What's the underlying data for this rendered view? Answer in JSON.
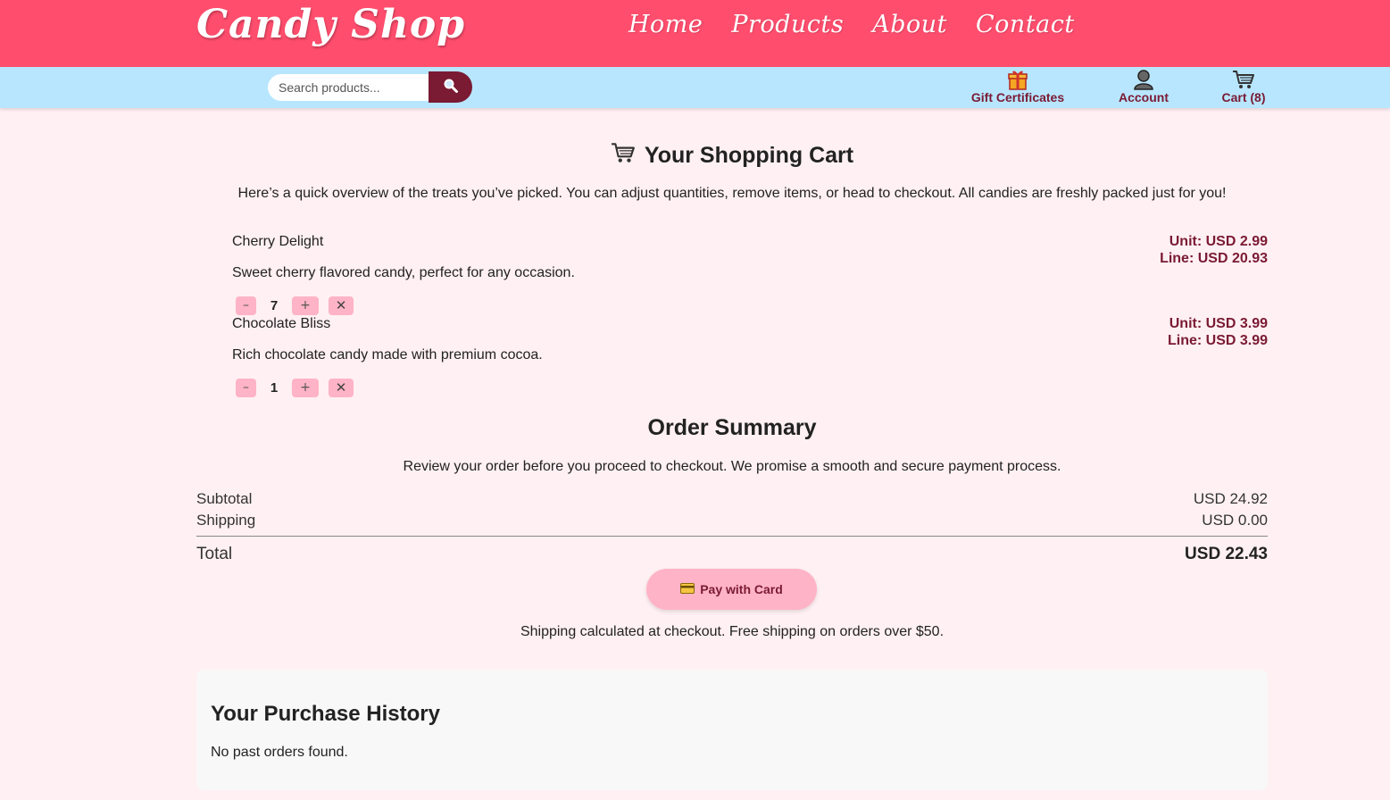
{
  "header": {
    "logo": "Candy Shop",
    "nav": [
      "Home",
      "Products",
      "About",
      "Contact"
    ]
  },
  "subheader": {
    "search_placeholder": "Search products...",
    "gift_label": "Gift Certificates",
    "account_label": "Account",
    "cart_label": "Cart (8)"
  },
  "cart": {
    "title": "Your Shopping Cart",
    "intro": "Here’s a quick overview of the treats you’ve picked. You can adjust quantities, remove items, or head to checkout. All candies are freshly packed just for you!",
    "items": [
      {
        "name": "Cherry Delight",
        "description": "Sweet cherry flavored candy, perfect for any occasion.",
        "qty": "7",
        "unit": "Unit: USD 2.99",
        "line": "Line: USD 20.93"
      },
      {
        "name": "Chocolate Bliss",
        "description": "Rich chocolate candy made with premium cocoa.",
        "qty": "1",
        "unit": "Unit: USD 3.99",
        "line": "Line: USD 3.99"
      }
    ],
    "minus_label": "–",
    "plus_label": "+",
    "remove_label": "✕"
  },
  "summary": {
    "title": "Order Summary",
    "note": "Review your order before you proceed to checkout. We promise a smooth and secure payment process.",
    "subtotal_label": "Subtotal",
    "subtotal_value": "USD 24.92",
    "shipping_label": "Shipping",
    "shipping_value": "USD 0.00",
    "total_label": "Total",
    "total_value": "USD 22.43",
    "pay_label": "Pay with Card",
    "shipping_note": "Shipping calculated at checkout. Free shipping on orders over $50."
  },
  "history": {
    "title": "Your Purchase History",
    "empty": "No past orders found."
  },
  "colors": {
    "brand_pink": "#ff4d6d",
    "light_blue": "#b8e6ff",
    "maroon": "#7a1a33",
    "button_pink": "#ffb3c6",
    "page_bg": "#fff0f3"
  }
}
